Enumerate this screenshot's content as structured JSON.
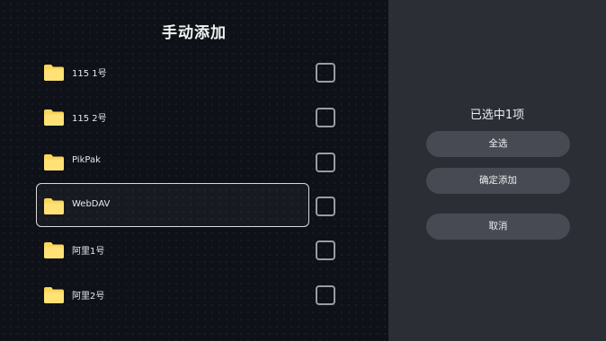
{
  "dialog": {
    "title": "手动添加",
    "status": "已选中1项"
  },
  "items": [
    {
      "label": "115 1号",
      "checked": false,
      "selected": false
    },
    {
      "label": "115 2号",
      "checked": false,
      "selected": false
    },
    {
      "label": "PikPak",
      "checked": false,
      "selected": false
    },
    {
      "label": "WebDAV",
      "checked": false,
      "selected": true
    },
    {
      "label": "阿里1号",
      "checked": false,
      "selected": false
    },
    {
      "label": "阿里2号",
      "checked": false,
      "selected": false
    }
  ],
  "actions": {
    "select_all": "全选",
    "confirm_add": "确定添加",
    "cancel": "取消"
  },
  "icons": {
    "item": "folder-icon"
  },
  "colors": {
    "folder": "#fbd65a",
    "left_bg": "#0e1117",
    "right_bg": "#2b2e35",
    "button_bg": "#474a52"
  }
}
